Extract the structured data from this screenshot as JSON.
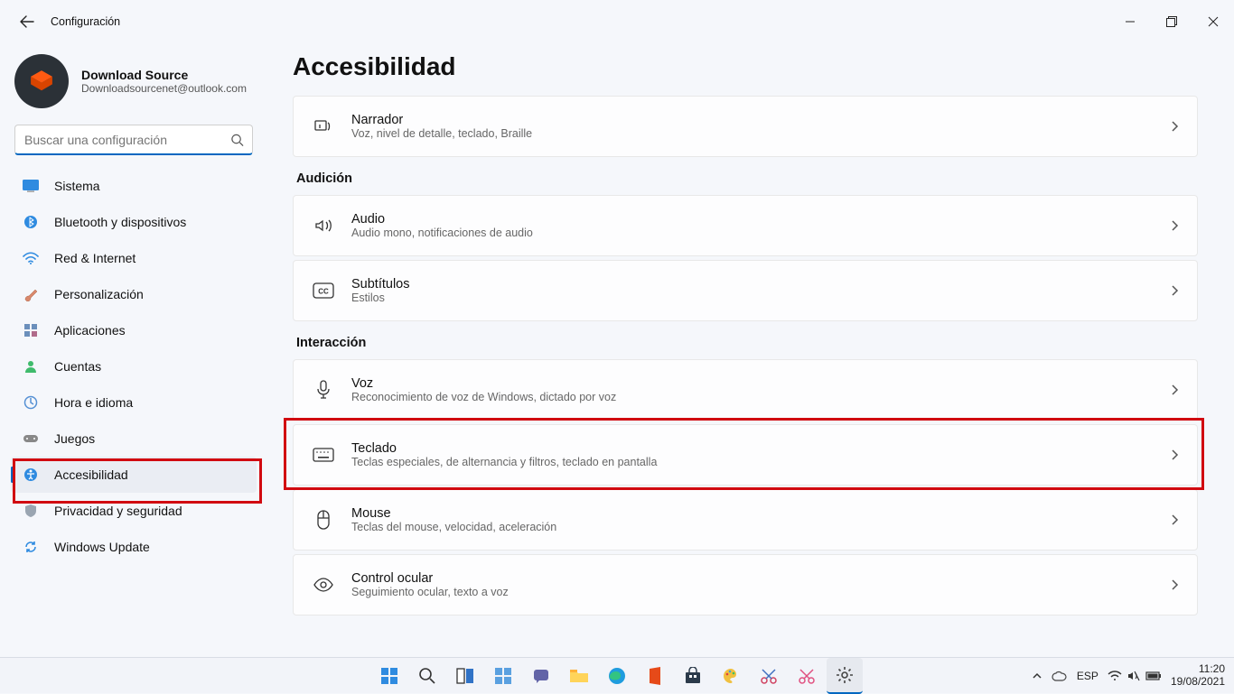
{
  "window": {
    "title": "Configuración"
  },
  "profile": {
    "name": "Download Source",
    "email": "Downloadsourcenet@outlook.com"
  },
  "search": {
    "placeholder": "Buscar una configuración"
  },
  "nav": {
    "system": "Sistema",
    "bluetooth": "Bluetooth y dispositivos",
    "network": "Red & Internet",
    "personalization": "Personalización",
    "apps": "Aplicaciones",
    "accounts": "Cuentas",
    "time": "Hora e idioma",
    "gaming": "Juegos",
    "accessibility": "Accesibilidad",
    "privacy": "Privacidad y seguridad",
    "update": "Windows Update"
  },
  "main": {
    "title": "Accesibilidad",
    "sections": {
      "hearing": "Audición",
      "interaction": "Interacción"
    },
    "cards": {
      "narrator": {
        "title": "Narrador",
        "sub": "Voz, nivel de detalle, teclado, Braille"
      },
      "audio": {
        "title": "Audio",
        "sub": "Audio mono, notificaciones de audio"
      },
      "captions": {
        "title": "Subtítulos",
        "sub": "Estilos"
      },
      "speech": {
        "title": "Voz",
        "sub": "Reconocimiento de voz de Windows, dictado por voz"
      },
      "keyboard": {
        "title": "Teclado",
        "sub": "Teclas especiales, de alternancia y filtros, teclado en pantalla"
      },
      "mouse": {
        "title": "Mouse",
        "sub": "Teclas del mouse, velocidad, aceleración"
      },
      "eye": {
        "title": "Control ocular",
        "sub": "Seguimiento ocular, texto a voz"
      }
    }
  },
  "taskbar": {
    "language": "ESP",
    "time": "11:20",
    "date": "19/08/2021"
  }
}
